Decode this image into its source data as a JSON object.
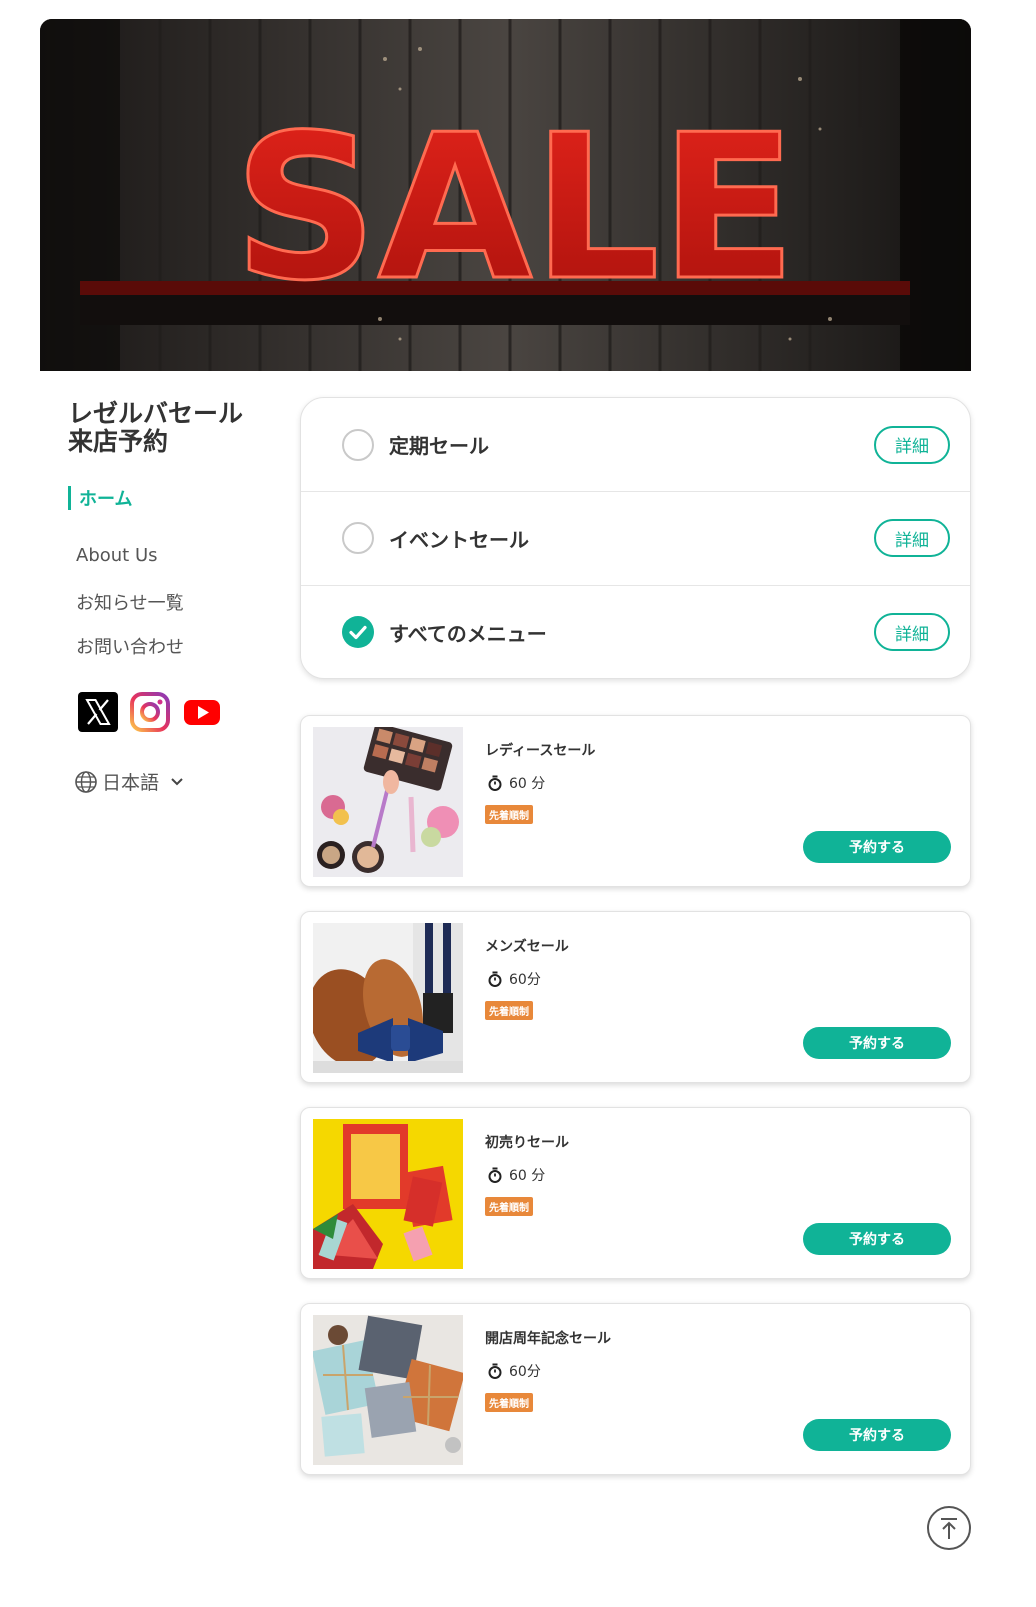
{
  "hero": {
    "sign_text": "SALE"
  },
  "sidebar": {
    "title_line1": "レゼルバセール",
    "title_line2": "来店予約",
    "nav": {
      "home": "ホーム",
      "about": "About Us",
      "news": "お知らせ一覧",
      "contact": "お問い合わせ"
    },
    "socials": [
      "x-icon",
      "instagram-icon",
      "youtube-icon"
    ],
    "language": "日本語"
  },
  "categories": [
    {
      "label": "定期セール",
      "checked": false,
      "button": "詳細"
    },
    {
      "label": "イベントセール",
      "checked": false,
      "button": "詳細"
    },
    {
      "label": "すべてのメニュー",
      "checked": true,
      "button": "詳細"
    }
  ],
  "menus": [
    {
      "title": "レディースセール",
      "duration": "60 分",
      "badge": "先着順制",
      "button": "予約する",
      "image": "cosmetics-photo"
    },
    {
      "title": "メンズセール",
      "duration": "60分",
      "badge": "先着順制",
      "button": "予約する",
      "image": "shoes-bowtie-photo"
    },
    {
      "title": "初売りセール",
      "duration": "60 分",
      "badge": "先着順制",
      "button": "予約する",
      "image": "new-year-lucky-bag-photo"
    },
    {
      "title": "開店周年記念セール",
      "duration": "60分",
      "badge": "先着順制",
      "button": "予約する",
      "image": "gift-boxes-photo"
    }
  ],
  "colors": {
    "accent": "#10b397",
    "badge": "#e8883a"
  }
}
